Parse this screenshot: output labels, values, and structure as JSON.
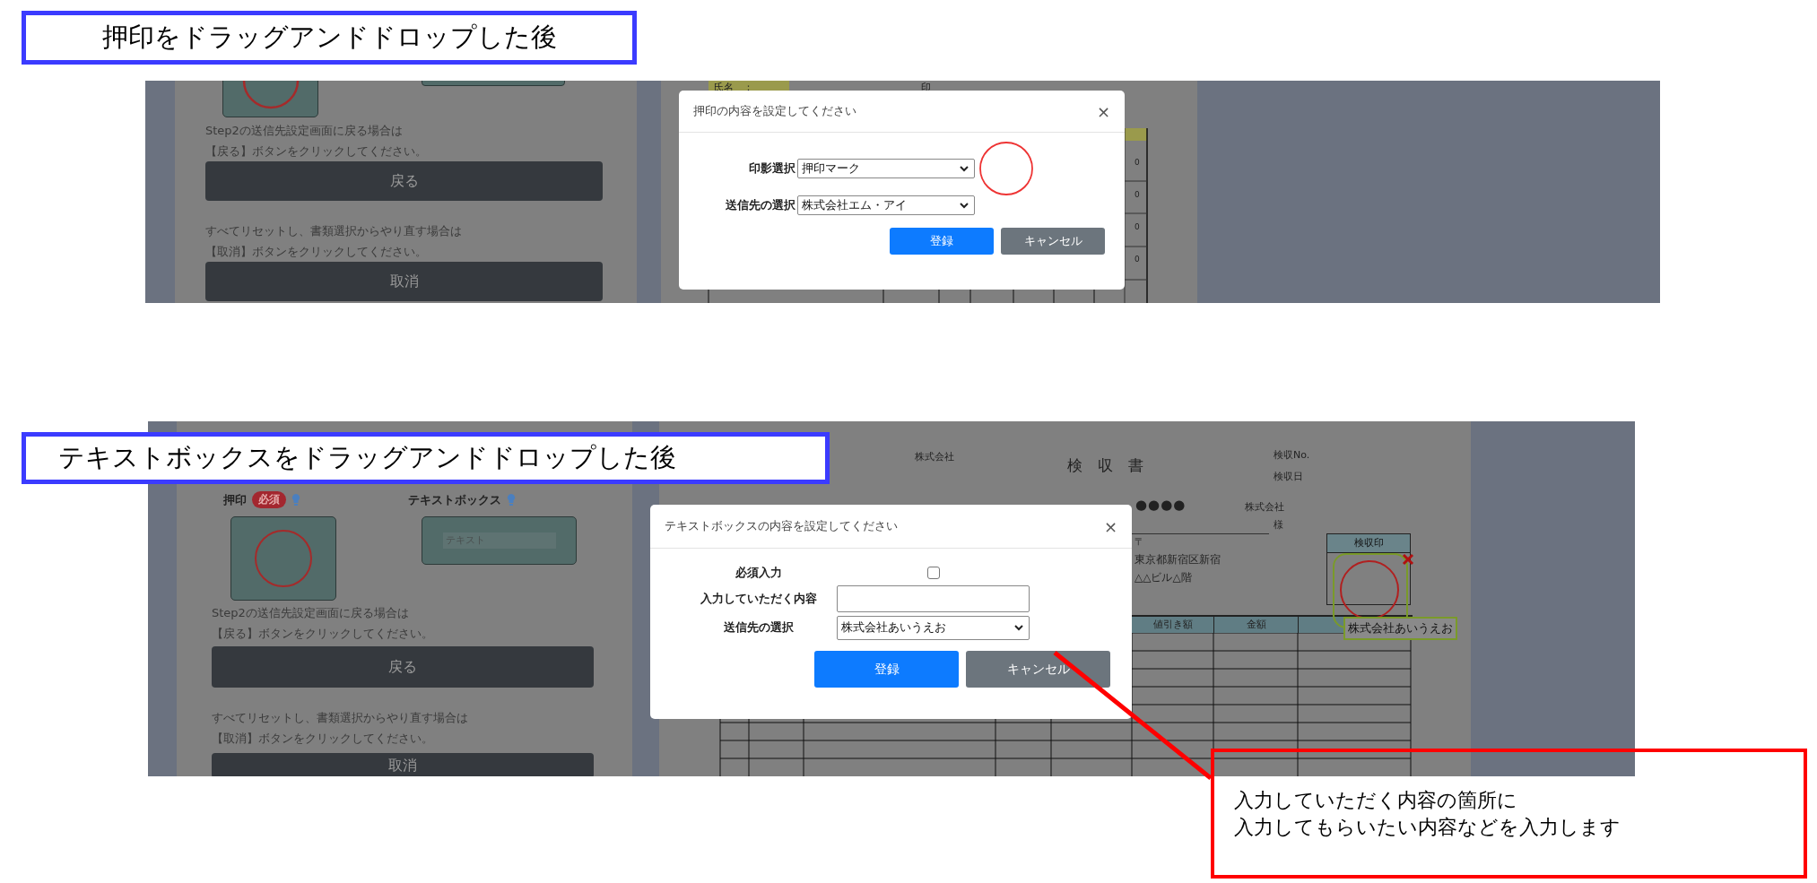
{
  "heading_1": "押印をドラッグアンドドロップした後",
  "screenshot_1": {
    "side_panel": {
      "lines_back": [
        "Step2の送信先設定画面に戻る場合は",
        "【戻る】ボタンをクリックしてください。"
      ],
      "back_button": "戻る",
      "lines_cancel": [
        "すべてリセットし、書類選択からやり直す場合は",
        "【取消】ボタンをクリックしてください。"
      ],
      "cancel_button": "取消"
    },
    "document": {
      "name_label": "氏名　：",
      "seal_label": "印",
      "totals": [
        "0",
        "0",
        "0",
        "0"
      ]
    },
    "dialog": {
      "title": "押印の内容を設定してください",
      "close": "×",
      "fields": [
        {
          "kind": "select",
          "label": "印影選択",
          "value": "押印マーク",
          "stamp_preview": true
        },
        {
          "kind": "select",
          "label": "送信先の選択",
          "value": "株式会社エム・アイ"
        }
      ],
      "buttons": [
        {
          "kind": "primary",
          "label": "登録"
        },
        {
          "kind": "secondary",
          "label": "キャンセル"
        }
      ]
    }
  },
  "heading_2": "テキストボックスをドラッグアンドドロップした後",
  "screenshot_2": {
    "side_panel": {
      "stamp_label": "押印",
      "required_badge": "必須",
      "textbox_label": "テキストボックス",
      "textbox_placeholder": "テキスト",
      "lines_back": [
        "Step2の送信先設定画面に戻る場合は",
        "【戻る】ボタンをクリックしてください。"
      ],
      "back_button": "戻る",
      "lines_cancel": [
        "すべてリセットし、書類選択からやり直す場合は",
        "【取消】ボタンをクリックしてください。"
      ],
      "cancel_button": "取消"
    },
    "document": {
      "company_top": "株式会社",
      "title": "検　収　書",
      "number_label": "検収No.",
      "date_label": "検収日",
      "recipient": "●●●●",
      "company_right": "株式会社",
      "honorific": "様",
      "postal": "〒",
      "address_lines": [
        "東京都新宿区新宿",
        "△△ビル△階"
      ],
      "seal_header": "検収印",
      "columns": [
        "値引き額",
        "金額"
      ],
      "placed_textbox": "株式会社あいうえお"
    },
    "dialog": {
      "title": "テキストボックスの内容を設定してください",
      "close": "×",
      "fields": [
        {
          "kind": "checkbox",
          "label": "必須入力",
          "checked": false
        },
        {
          "kind": "text",
          "label": "入力していただく内容"
        },
        {
          "kind": "select",
          "label": "送信先の選択",
          "value": "株式会社あいうえお"
        }
      ],
      "buttons": [
        {
          "kind": "primary",
          "label": "登録"
        },
        {
          "kind": "secondary",
          "label": "キャンセル"
        }
      ]
    }
  },
  "callout": {
    "lines": [
      "入力していただく内容の箇所に",
      "入力してもらいたい内容などを入力します"
    ]
  }
}
